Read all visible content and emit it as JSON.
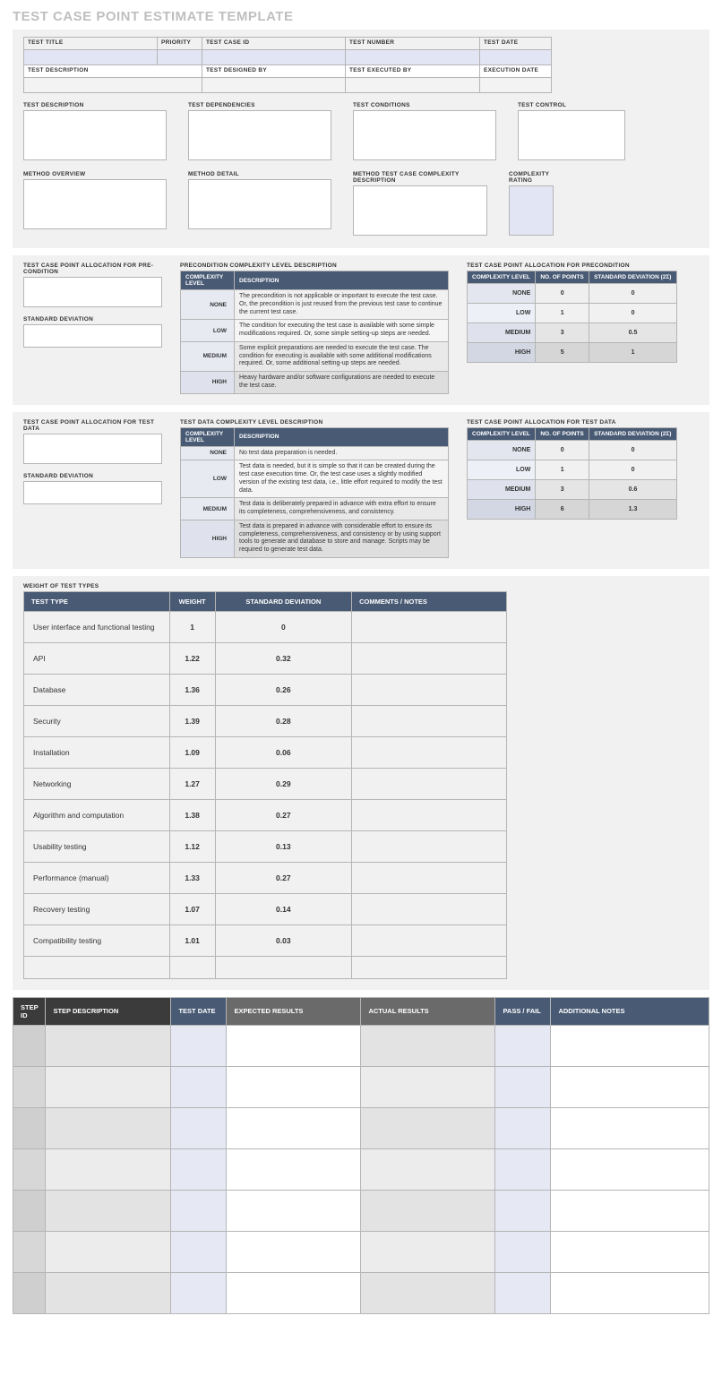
{
  "title": "TEST CASE POINT ESTIMATE TEMPLATE",
  "header": {
    "row1": {
      "test_title": "TEST TITLE",
      "priority": "PRIORITY",
      "test_case_id": "TEST CASE ID",
      "test_number": "TEST NUMBER",
      "test_date": "TEST DATE"
    },
    "row2": {
      "test_description": "TEST DESCRIPTION",
      "test_designed_by": "TEST DESIGNED BY",
      "test_executed_by": "TEST EXECUTED BY",
      "execution_date": "EXECUTION DATE"
    }
  },
  "blocks": {
    "test_description": "TEST DESCRIPTION",
    "test_dependencies": "TEST DEPENDENCIES",
    "test_conditions": "TEST CONDITIONS",
    "test_control": "TEST CONTROL",
    "method_overview": "METHOD OVERVIEW",
    "method_detail": "METHOD DETAIL",
    "method_complexity_desc": "METHOD TEST CASE COMPLEXITY DESCRIPTION",
    "complexity_rating": "COMPLEXITY RATING"
  },
  "precondition": {
    "alloc_title": "TEST CASE POINT ALLOCATION FOR PRE-CONDITION",
    "sd_title": "STANDARD DEVIATION",
    "desc_title": "PRECONDITION COMPLEXITY LEVEL DESCRIPTION",
    "alloc_table_title": "TEST CASE POINT ALLOCATION FOR PRECONDITION",
    "cols": {
      "level": "COMPLEXITY LEVEL",
      "desc": "DESCRIPTION",
      "points": "NO. OF POINTS",
      "sd": "STANDARD DEVIATION (2σ)"
    },
    "rows": [
      {
        "level": "NONE",
        "desc": "The precondition is not applicable or important to execute the test case. Or, the precondition is just reused from the previous test case to continue the current test case.",
        "points": "0",
        "sd": "0"
      },
      {
        "level": "LOW",
        "desc": "The condition for executing the test case is available with some simple modifications required. Or, some simple setting-up steps are needed.",
        "points": "1",
        "sd": "0"
      },
      {
        "level": "MEDIUM",
        "desc": "Some explicit preparations are needed to execute the test case. The condition for executing is available with some additional modifications required. Or, some additional setting-up steps are needed.",
        "points": "3",
        "sd": "0.5"
      },
      {
        "level": "HIGH",
        "desc": "Heavy hardware and/or software configurations are needed to execute the test case.",
        "points": "5",
        "sd": "1"
      }
    ]
  },
  "testdata": {
    "alloc_title": "TEST CASE POINT ALLOCATION FOR TEST DATA",
    "sd_title": "STANDARD DEVIATION",
    "desc_title": "TEST DATA COMPLEXITY LEVEL DESCRIPTION",
    "alloc_table_title": "TEST CASE POINT ALLOCATION FOR TEST DATA",
    "cols": {
      "level": "COMPLEXITY LEVEL",
      "desc": "DESCRIPTION",
      "points": "NO. OF POINTS",
      "sd": "STANDARD DEVIATION (2σ)"
    },
    "rows": [
      {
        "level": "NONE",
        "desc": "No test data preparation is needed.",
        "points": "0",
        "sd": "0"
      },
      {
        "level": "LOW",
        "desc": "Test data is needed, but it is simple so that it can be created during the test case execution time. Or, the test case uses a slightly modified version of the existing test data, i.e., little effort required to modify the test data.",
        "points": "1",
        "sd": "0"
      },
      {
        "level": "MEDIUM",
        "desc": "Test data is deliberately prepared in advance with extra effort to ensure its completeness, comprehensiveness, and consistency.",
        "points": "3",
        "sd": "0.6"
      },
      {
        "level": "HIGH",
        "desc": "Test data is prepared in advance with considerable effort to ensure its completeness, comprehensiveness, and consistency or by using support tools to generate and database to store and manage. Scripts may be required to generate test data.",
        "points": "6",
        "sd": "1.3"
      }
    ]
  },
  "weights": {
    "title": "WEIGHT OF TEST TYPES",
    "cols": {
      "type": "TEST TYPE",
      "weight": "WEIGHT",
      "sd": "STANDARD DEVIATION",
      "comments": "COMMENTS / NOTES"
    },
    "rows": [
      {
        "type": "User interface and functional testing",
        "weight": "1",
        "sd": "0"
      },
      {
        "type": "API",
        "weight": "1.22",
        "sd": "0.32"
      },
      {
        "type": "Database",
        "weight": "1.36",
        "sd": "0.26"
      },
      {
        "type": "Security",
        "weight": "1.39",
        "sd": "0.28"
      },
      {
        "type": "Installation",
        "weight": "1.09",
        "sd": "0.06"
      },
      {
        "type": "Networking",
        "weight": "1.27",
        "sd": "0.29"
      },
      {
        "type": "Algorithm and computation",
        "weight": "1.38",
        "sd": "0.27"
      },
      {
        "type": "Usability testing",
        "weight": "1.12",
        "sd": "0.13"
      },
      {
        "type": "Performance (manual)",
        "weight": "1.33",
        "sd": "0.27"
      },
      {
        "type": "Recovery testing",
        "weight": "1.07",
        "sd": "0.14"
      },
      {
        "type": "Compatibility testing",
        "weight": "1.01",
        "sd": "0.03"
      },
      {
        "type": "",
        "weight": "",
        "sd": ""
      }
    ]
  },
  "steps": {
    "cols": {
      "id": "STEP ID",
      "desc": "STEP DESCRIPTION",
      "date": "TEST DATE",
      "exp": "EXPECTED RESULTS",
      "act": "ACTUAL RESULTS",
      "pf": "PASS / FAIL",
      "notes": "ADDITIONAL NOTES"
    },
    "count": 7
  }
}
